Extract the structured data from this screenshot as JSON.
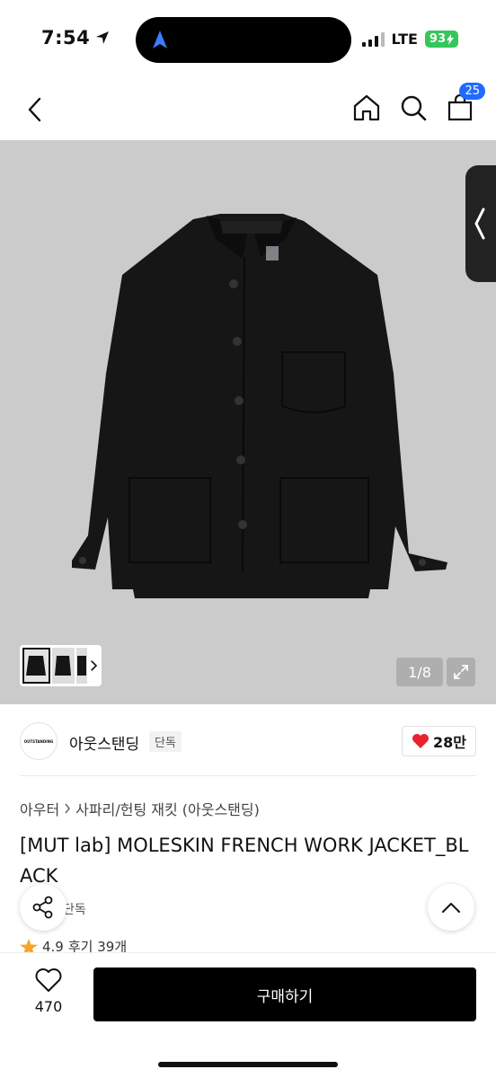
{
  "status": {
    "time": "7:54",
    "network": "LTE",
    "battery": "93"
  },
  "header": {
    "cart_count": "25"
  },
  "gallery": {
    "counter": "1/8",
    "has_more_thumbs": true
  },
  "brand": {
    "name": "아웃스탠딩",
    "tag": "단독",
    "logo_text": "OUTSTANDING",
    "likes": "28만"
  },
  "breadcrumb": {
    "level1": "아우터",
    "level2": "사파리/헌팅 재킷 (아웃스탠딩)"
  },
  "product": {
    "title": "[MUT lab] MOLESKIN FRENCH WORK JACKET_BLACK",
    "tag": "단독",
    "rating": "4.9",
    "reviews": "후기 39개"
  },
  "bottom": {
    "wish_count": "470",
    "buy_label": "구매하기"
  },
  "colors": {
    "accent": "#1f6bff",
    "heart": "#e8232f",
    "battery": "#34c759",
    "image_bg": "#cbcbcb"
  }
}
